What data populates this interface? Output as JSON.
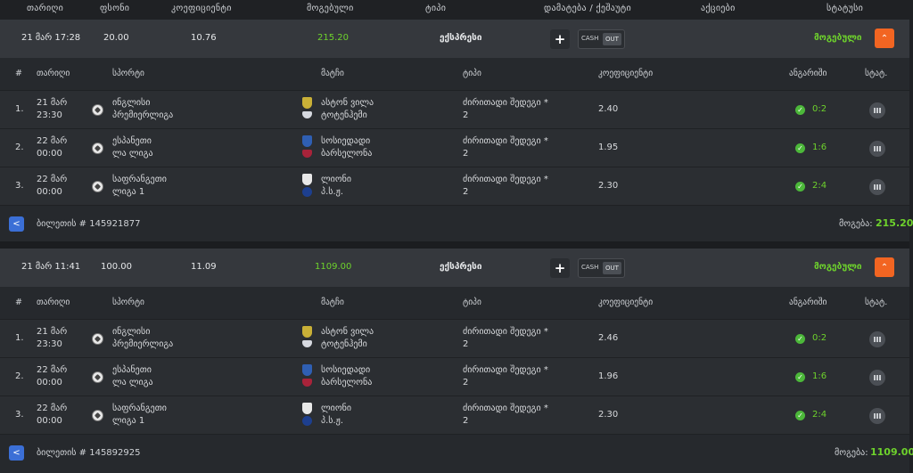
{
  "header": {
    "date": "თარიღი",
    "stake": "ფსონი",
    "coefficient": "კოეფიციენტი",
    "winning": "მოგებული",
    "type": "ტიპი",
    "increase_cashout": "დამატება / ქეშაუტი",
    "promotions": "აქციები",
    "status": "სტატუსი"
  },
  "columns": {
    "num": "#",
    "date": "თარიღი",
    "sport": "სპორტი",
    "match": "მატჩი",
    "type": "ტიპი",
    "coefficient": "კოეფიციენტი",
    "result": "ანგარიში",
    "stat": "სტატ."
  },
  "cashout": {
    "cash": "CASH",
    "out": "OUT"
  },
  "footer_labels": {
    "win": "მოგება:"
  },
  "colors": {
    "accent": "#f26522",
    "win": "#6ed32c",
    "share": "#3b6fd6"
  },
  "tickets": [
    {
      "date": "21 მარ 17:28",
      "stake": "20.00",
      "coefficient": "10.76",
      "winning": "215.20",
      "type": "ექსპრესი",
      "status": "მოგებული",
      "ticket_id": "ბილეთის # 145921877",
      "win_amount": "215.20",
      "rows": [
        {
          "num": "1.",
          "date1": "21 მარ",
          "date2": "23:30",
          "sport1": "ინგლისი",
          "sport2": "პრემიერლიგა",
          "team1": "ასტონ ვილა",
          "team2": "ტოტენჰემი",
          "type1": "ძირითადი შედეგი *",
          "type2": "2",
          "coef": "2.40",
          "score": "0:2"
        },
        {
          "num": "2.",
          "date1": "22 მარ",
          "date2": "00:00",
          "sport1": "ესპანეთი",
          "sport2": "ლა ლიგა",
          "team1": "სოსიედადი",
          "team2": "ბარსელონა",
          "type1": "ძირითადი შედეგი *",
          "type2": "2",
          "coef": "1.95",
          "score": "1:6"
        },
        {
          "num": "3.",
          "date1": "22 მარ",
          "date2": "00:00",
          "sport1": "საფრანგეთი",
          "sport2": "ლიგა 1",
          "team1": "ლიონი",
          "team2": "პ.ს.ჟ.",
          "type1": "ძირითადი შედეგი *",
          "type2": "2",
          "coef": "2.30",
          "score": "2:4"
        }
      ]
    },
    {
      "date": "21 მარ 11:41",
      "stake": "100.00",
      "coefficient": "11.09",
      "winning": "1109.00",
      "type": "ექსპრესი",
      "status": "მოგებული",
      "ticket_id": "ბილეთის # 145892925",
      "win_amount": "1109.00",
      "rows": [
        {
          "num": "1.",
          "date1": "21 მარ",
          "date2": "23:30",
          "sport1": "ინგლისი",
          "sport2": "პრემიერლიგა",
          "team1": "ასტონ ვილა",
          "team2": "ტოტენჰემი",
          "type1": "ძირითადი შედეგი *",
          "type2": "2",
          "coef": "2.46",
          "score": "0:2"
        },
        {
          "num": "2.",
          "date1": "22 მარ",
          "date2": "00:00",
          "sport1": "ესპანეთი",
          "sport2": "ლა ლიგა",
          "team1": "სოსიედადი",
          "team2": "ბარსელონა",
          "type1": "ძირითადი შედეგი *",
          "type2": "2",
          "coef": "1.96",
          "score": "1:6"
        },
        {
          "num": "3.",
          "date1": "22 მარ",
          "date2": "00:00",
          "sport1": "საფრანგეთი",
          "sport2": "ლიგა 1",
          "team1": "ლიონი",
          "team2": "პ.ს.ჟ.",
          "type1": "ძირითადი შედეგი *",
          "type2": "2",
          "coef": "2.30",
          "score": "2:4"
        }
      ]
    }
  ]
}
